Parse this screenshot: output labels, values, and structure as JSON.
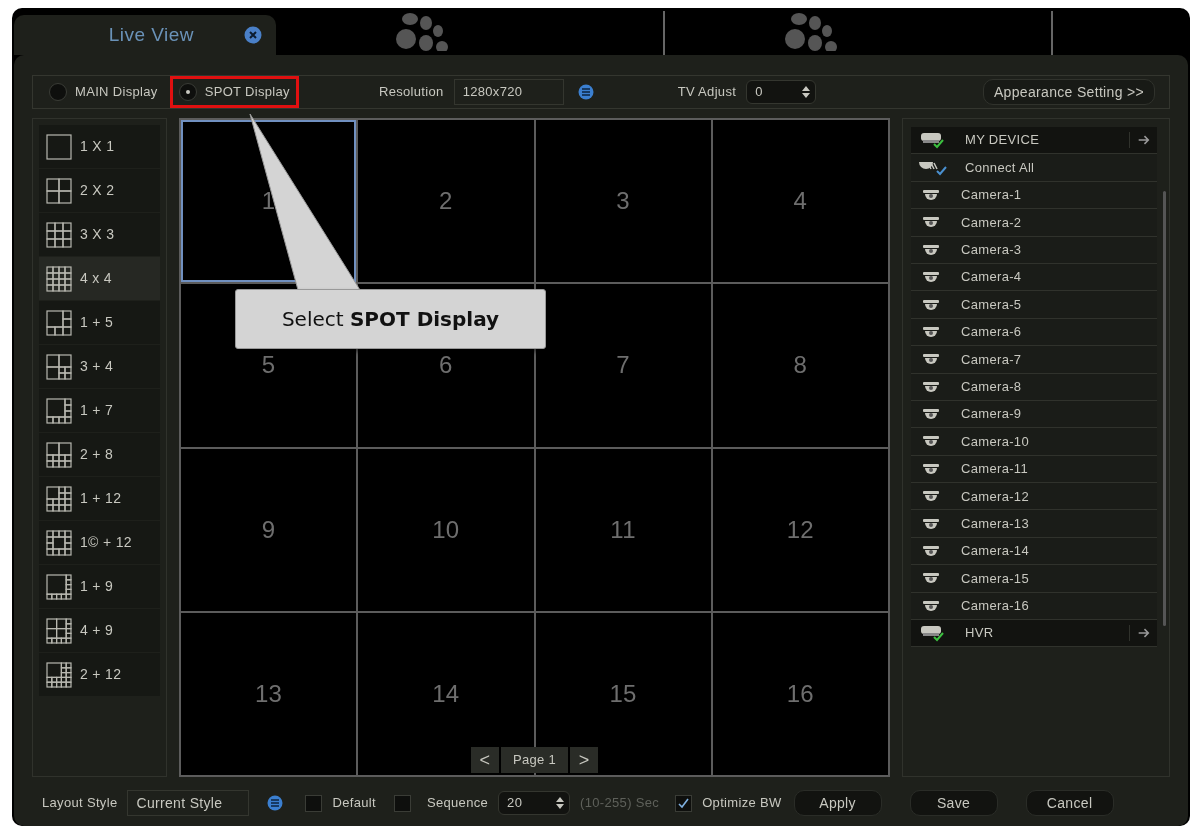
{
  "tabs": [
    {
      "kind": "view",
      "label": "Live View",
      "selected": true
    },
    {
      "kind": "loading",
      "selected": false
    },
    {
      "kind": "loading",
      "selected": false
    }
  ],
  "toolbar": {
    "display_modes": [
      {
        "label": "MAIN Display",
        "selected": false,
        "highlighted": false
      },
      {
        "label": "SPOT Display",
        "selected": true,
        "highlighted": true
      }
    ],
    "resolution": {
      "label": "Resolution",
      "value": "1280x720"
    },
    "tv_adjust": {
      "label": "TV Adjust",
      "value": "0"
    },
    "appearance_button": "Appearance Setting >>"
  },
  "layouts": [
    {
      "label": "1 X 1",
      "kind": "single",
      "selected": false
    },
    {
      "label": "2 X 2",
      "kind": "quad",
      "selected": false
    },
    {
      "label": "3 X 3",
      "kind": "nine",
      "selected": false
    },
    {
      "label": "4 x 4",
      "kind": "sixteen",
      "selected": true
    },
    {
      "label": "1 + 5",
      "kind": "sixmain",
      "selected": false
    },
    {
      "label": "3 + 4",
      "kind": "sevenmix",
      "selected": false
    },
    {
      "label": "1 + 7",
      "kind": "eightmain",
      "selected": false
    },
    {
      "label": "2 + 8",
      "kind": "tenmix",
      "selected": false
    },
    {
      "label": "1 + 12",
      "kind": "thirteencorner",
      "selected": false
    },
    {
      "label": "1© + 12",
      "kind": "thirteencenter",
      "selected": false
    },
    {
      "label": "1 + 9",
      "kind": "tenmain",
      "selected": false
    },
    {
      "label": "4 + 9",
      "kind": "thirteenmix",
      "selected": false
    },
    {
      "label": "2 + 12",
      "kind": "fourteenmix",
      "selected": false
    }
  ],
  "channels": [
    {
      "label": "1",
      "selected": true
    },
    {
      "label": "2",
      "selected": false
    },
    {
      "label": "3",
      "selected": false
    },
    {
      "label": "4",
      "selected": false
    },
    {
      "label": "5",
      "selected": false
    },
    {
      "label": "6",
      "selected": false
    },
    {
      "label": "7",
      "selected": false
    },
    {
      "label": "8",
      "selected": false
    },
    {
      "label": "9",
      "selected": false
    },
    {
      "label": "10",
      "selected": false
    },
    {
      "label": "11",
      "selected": false
    },
    {
      "label": "12",
      "selected": false
    },
    {
      "label": "13",
      "selected": false
    },
    {
      "label": "14",
      "selected": false
    },
    {
      "label": "15",
      "selected": false
    },
    {
      "label": "16",
      "selected": false
    }
  ],
  "pager": {
    "label": "Page 1",
    "prev": "<",
    "next": ">"
  },
  "devices": [
    {
      "kind": "group",
      "label": "MY DEVICE"
    },
    {
      "kind": "connect_all",
      "label": "Connect All"
    },
    {
      "kind": "camera",
      "label": "Camera-1"
    },
    {
      "kind": "camera",
      "label": "Camera-2"
    },
    {
      "kind": "camera",
      "label": "Camera-3"
    },
    {
      "kind": "camera",
      "label": "Camera-4"
    },
    {
      "kind": "camera",
      "label": "Camera-5"
    },
    {
      "kind": "camera",
      "label": "Camera-6"
    },
    {
      "kind": "camera",
      "label": "Camera-7"
    },
    {
      "kind": "camera",
      "label": "Camera-8"
    },
    {
      "kind": "camera",
      "label": "Camera-9"
    },
    {
      "kind": "camera",
      "label": "Camera-10"
    },
    {
      "kind": "camera",
      "label": "Camera-11"
    },
    {
      "kind": "camera",
      "label": "Camera-12"
    },
    {
      "kind": "camera",
      "label": "Camera-13"
    },
    {
      "kind": "camera",
      "label": "Camera-14"
    },
    {
      "kind": "camera",
      "label": "Camera-15"
    },
    {
      "kind": "camera",
      "label": "Camera-16"
    },
    {
      "kind": "group",
      "label": "HVR"
    }
  ],
  "bottom_bar": {
    "layout_style": {
      "label": "Layout Style",
      "value": "Current Style"
    },
    "default": {
      "label": "Default",
      "checked": false
    },
    "sequence": {
      "label": "Sequence",
      "checked": false,
      "value": "20",
      "range": "(10-255) Sec"
    },
    "optimize_bw": {
      "label": "Optimize BW",
      "checked": true
    },
    "buttons": [
      "Apply",
      "Save",
      "Cancel"
    ]
  },
  "callout": {
    "text": "Select **SPOT Display**"
  }
}
